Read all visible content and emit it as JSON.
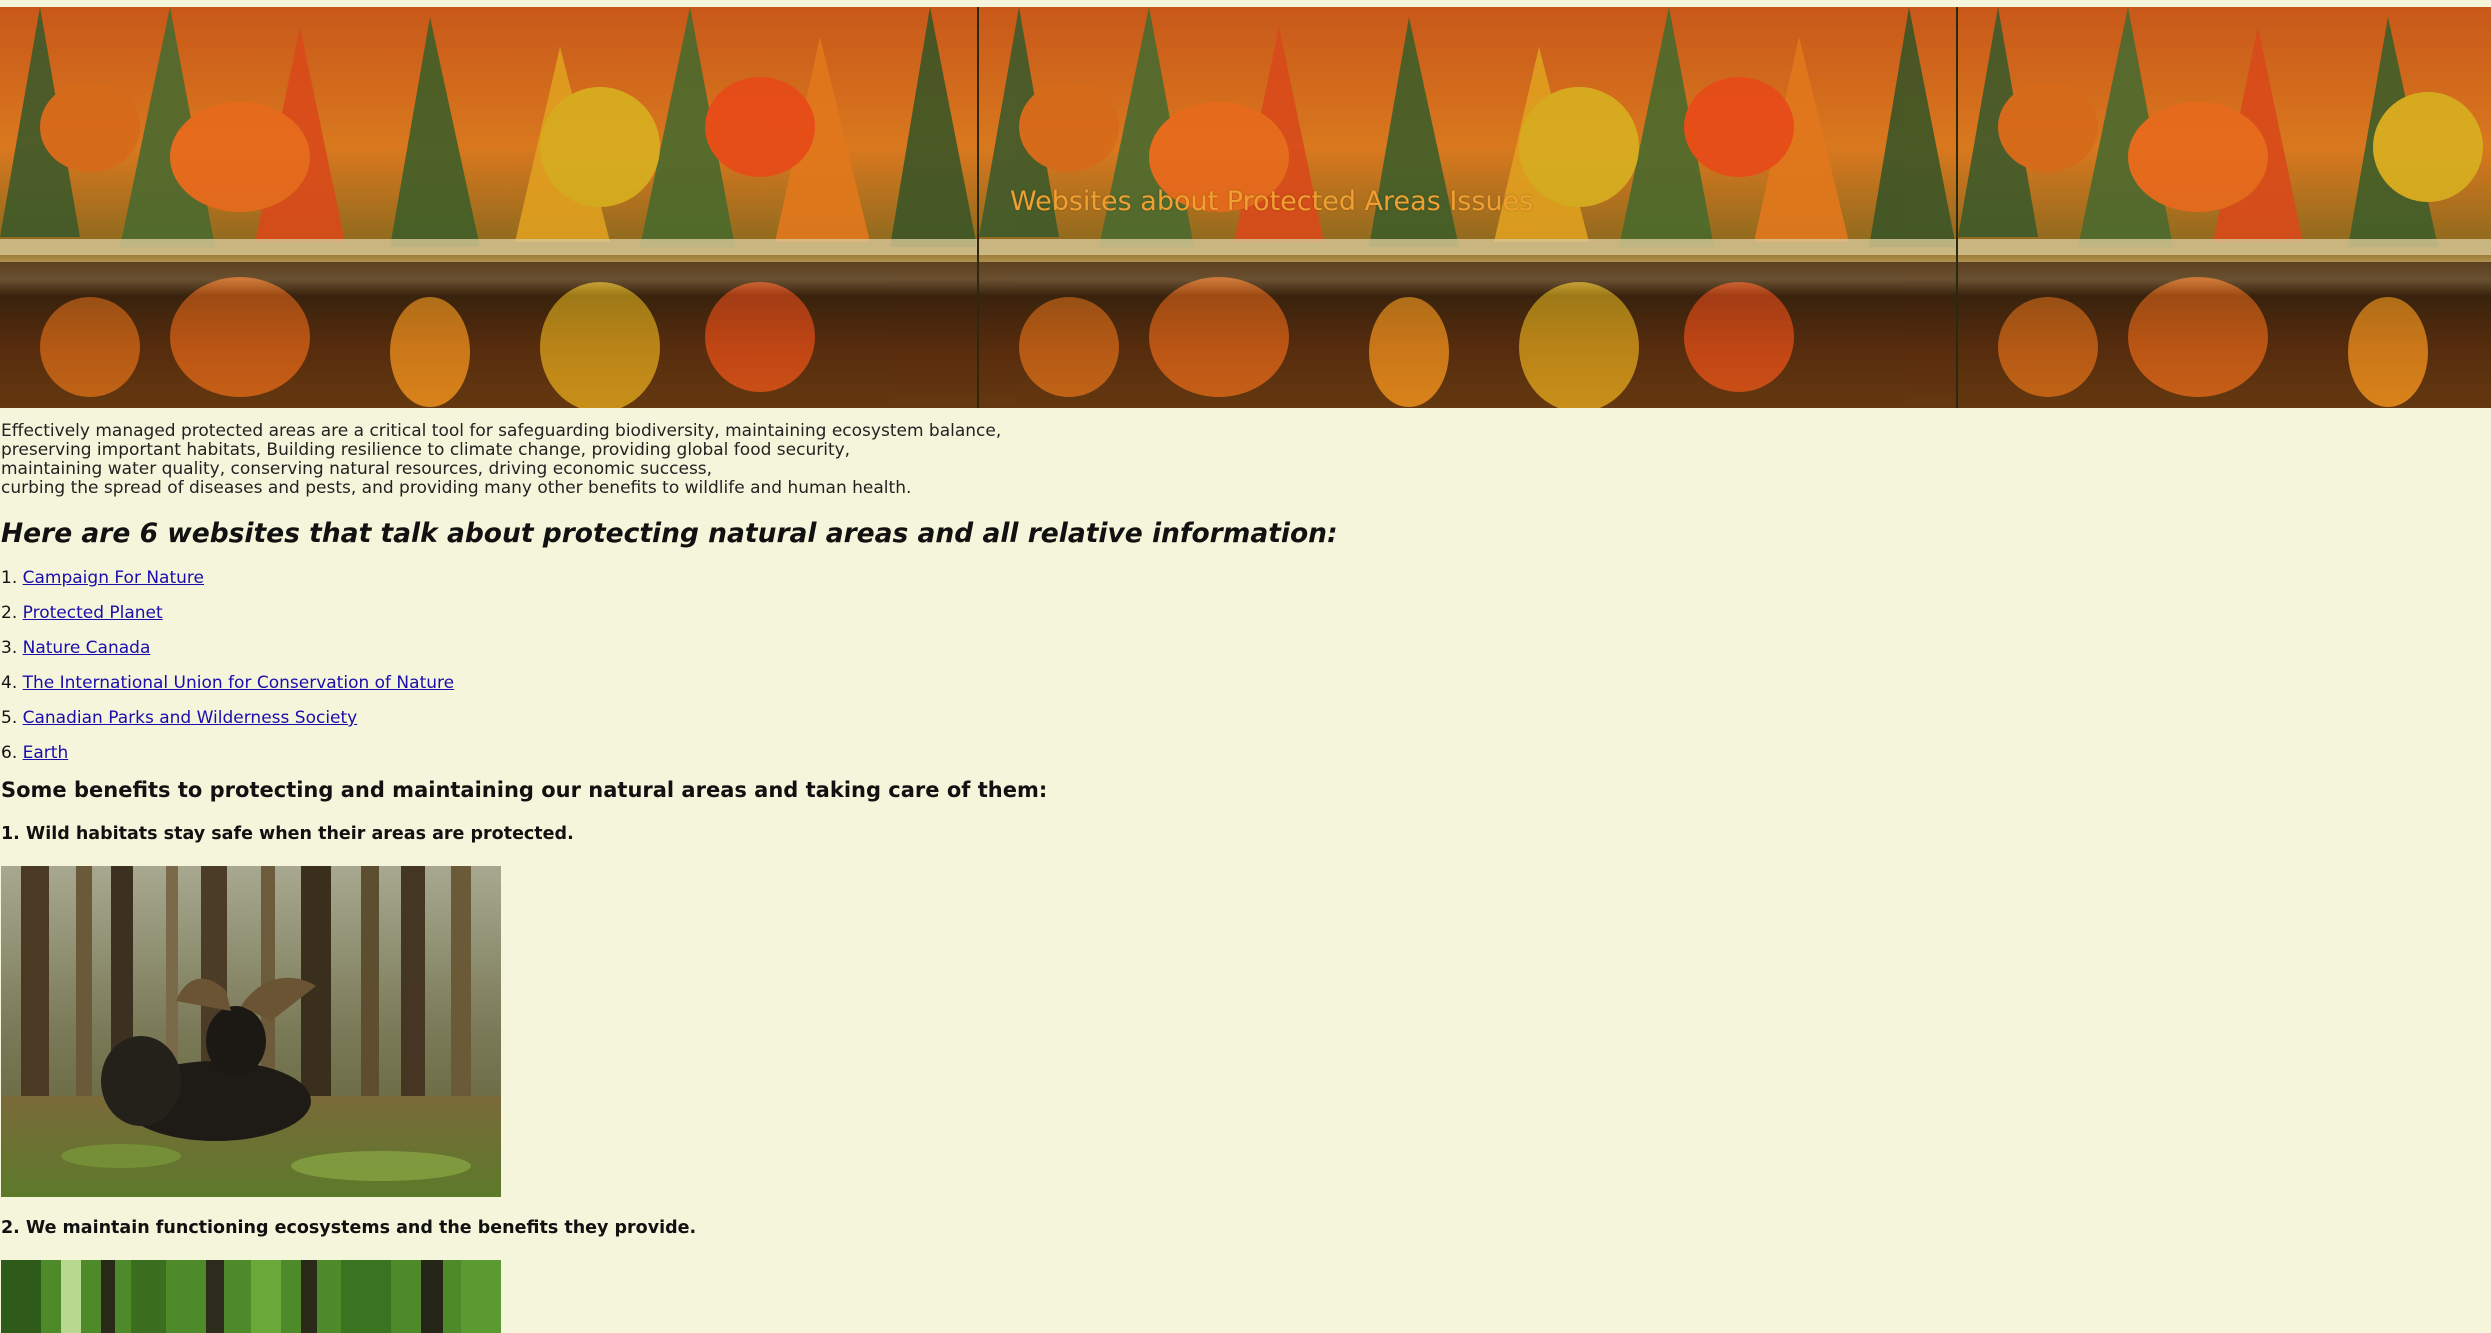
{
  "banner": {
    "title": "Websites about Protected Areas Issues"
  },
  "intro": {
    "lines": [
      "Effectively managed protected areas are a critical tool for safeguarding biodiversity, maintaining ecosystem balance,",
      "preserving important habitats, Building resilience to climate change, providing global food security,",
      "maintaining water quality, conserving natural resources, driving economic success,",
      "curbing the spread of diseases and pests, and providing many other benefits to wildlife and human health."
    ]
  },
  "websites": {
    "heading": "Here are 6 websites that talk about protecting natural areas and all relative information:",
    "items": [
      {
        "num": "1.",
        "label": "Campaign For Nature"
      },
      {
        "num": "2.",
        "label": "Protected Planet"
      },
      {
        "num": "3.",
        "label": "Nature Canada"
      },
      {
        "num": "4.",
        "label": "The International Union for Conservation of Nature"
      },
      {
        "num": "5.",
        "label": "Canadian Parks and Wilderness Society"
      },
      {
        "num": "6.",
        "label": "Earth"
      }
    ]
  },
  "benefits": {
    "heading": "Some benefits to protecting and maintaining our natural areas and taking care of them:",
    "items": [
      {
        "label": "1. Wild habitats stay safe when their areas are protected."
      },
      {
        "label": "2. We maintain functioning ecosystems and the benefits they provide."
      }
    ]
  },
  "colors": {
    "background": "#f5f5dc",
    "banner_title": "#f0a030",
    "link": "#1a0dab"
  }
}
